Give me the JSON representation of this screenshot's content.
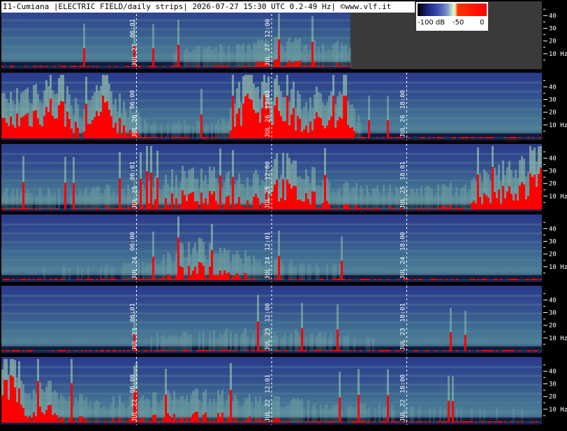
{
  "header": {
    "title": "I1-Cumiana |ELECTRIC FIELD/daily strips| 2026-07-27 15:30 UTC 0.2-49 Hz| ©www.vlf.it"
  },
  "colorbar": {
    "labels": [
      "-100 dB",
      "-50",
      "0"
    ],
    "colors": [
      "#000000",
      "#1a237e",
      "#5c6bc0",
      "#c8e6c9",
      "#ff0000"
    ]
  },
  "colors": {
    "background": "#000000",
    "no_data": "#3a3a3a",
    "spectrogram_low": "#283593",
    "spectrogram_mid": "#6a9a8a",
    "spectrogram_high": "#c8e6c9",
    "saturation": "#ff0000"
  },
  "chart_data": {
    "type": "heatmap",
    "ylabel": "Hz",
    "y_ticks": [
      {
        "value": 10,
        "label": "10 Hz"
      },
      {
        "value": 20,
        "label": "20"
      },
      {
        "value": 30,
        "label": "30"
      },
      {
        "value": 40,
        "label": "40"
      }
    ],
    "ylim": [
      0,
      49
    ],
    "xlim_hours": [
      0,
      24
    ],
    "strips": [
      {
        "date_label": "JUL 27",
        "data_until_hour": 15.5,
        "markers": [
          {
            "hour": 6,
            "label": "06:01"
          },
          {
            "hour": 12,
            "label": "12:00"
          }
        ],
        "activity": [
          {
            "h": 0,
            "v": 0.1
          },
          {
            "h": 6,
            "v": 0.15
          },
          {
            "h": 11,
            "v": 0.35
          },
          {
            "h": 13,
            "v": 0.4
          },
          {
            "h": 15.5,
            "v": 0.3
          }
        ]
      },
      {
        "date_label": "JUL 26",
        "data_until_hour": 24,
        "markers": [
          {
            "hour": 6,
            "label": "06:00"
          },
          {
            "hour": 12,
            "label": "12:01"
          },
          {
            "hour": 18,
            "label": "18:00"
          }
        ],
        "activity": [
          {
            "h": 0,
            "v": 0.6
          },
          {
            "h": 1,
            "v": 0.75
          },
          {
            "h": 2.5,
            "v": 0.95
          },
          {
            "h": 3.5,
            "v": 0.4
          },
          {
            "h": 4.5,
            "v": 0.85
          },
          {
            "h": 6.5,
            "v": 0.2
          },
          {
            "h": 10,
            "v": 0.25
          },
          {
            "h": 10.5,
            "v": 0.9
          },
          {
            "h": 11.5,
            "v": 1.0
          },
          {
            "h": 13,
            "v": 0.7
          },
          {
            "h": 15.5,
            "v": 0.6
          },
          {
            "h": 16,
            "v": 0.15
          },
          {
            "h": 24,
            "v": 0.1
          }
        ]
      },
      {
        "date_label": "JUL 25",
        "data_until_hour": 24,
        "markers": [
          {
            "hour": 6,
            "label": "06:01"
          },
          {
            "hour": 12,
            "label": "12:00"
          },
          {
            "hour": 18,
            "label": "18:01"
          }
        ],
        "activity": [
          {
            "h": 0,
            "v": 0.3
          },
          {
            "h": 3,
            "v": 0.25
          },
          {
            "h": 6.5,
            "v": 0.4
          },
          {
            "h": 8,
            "v": 0.55
          },
          {
            "h": 11.5,
            "v": 0.5
          },
          {
            "h": 12,
            "v": 0.8
          },
          {
            "h": 15,
            "v": 0.35
          },
          {
            "h": 18,
            "v": 0.3
          },
          {
            "h": 20.5,
            "v": 0.35
          },
          {
            "h": 22,
            "v": 0.6
          },
          {
            "h": 24,
            "v": 0.9
          }
        ]
      },
      {
        "date_label": "JUL 24",
        "data_until_hour": 24,
        "markers": [
          {
            "hour": 6,
            "label": "06:00"
          },
          {
            "hour": 12,
            "label": "12:01"
          },
          {
            "hour": 18,
            "label": "18:00"
          }
        ],
        "activity": [
          {
            "h": 0,
            "v": 0.15
          },
          {
            "h": 5,
            "v": 0.2
          },
          {
            "h": 7,
            "v": 0.3
          },
          {
            "h": 8.5,
            "v": 0.6
          },
          {
            "h": 9.5,
            "v": 0.45
          },
          {
            "h": 12,
            "v": 0.3
          },
          {
            "h": 15,
            "v": 0.2
          },
          {
            "h": 18,
            "v": 0.1
          },
          {
            "h": 24,
            "v": 0.05
          }
        ]
      },
      {
        "date_label": "JUL 23",
        "data_until_hour": 24,
        "markers": [
          {
            "hour": 6,
            "label": "06:01"
          },
          {
            "hour": 12,
            "label": "12:00"
          },
          {
            "hour": 18,
            "label": "18:01"
          }
        ],
        "activity": [
          {
            "h": 0,
            "v": 0.05
          },
          {
            "h": 6,
            "v": 0.1
          },
          {
            "h": 7,
            "v": 0.25
          },
          {
            "h": 12,
            "v": 0.3
          },
          {
            "h": 16,
            "v": 0.2
          },
          {
            "h": 20,
            "v": 0.1
          },
          {
            "h": 24,
            "v": 0.05
          }
        ]
      },
      {
        "date_label": "JUL 22",
        "data_until_hour": 24,
        "markers": [
          {
            "hour": 6,
            "label": "06:00"
          },
          {
            "hour": 12,
            "label": "12:01"
          },
          {
            "hour": 18,
            "label": "18:00"
          }
        ],
        "activity": [
          {
            "h": 0,
            "v": 1.0
          },
          {
            "h": 0.6,
            "v": 0.9
          },
          {
            "h": 1,
            "v": 0.5
          },
          {
            "h": 2,
            "v": 0.55
          },
          {
            "h": 4,
            "v": 0.3
          },
          {
            "h": 7,
            "v": 0.4
          },
          {
            "h": 9,
            "v": 0.45
          },
          {
            "h": 12,
            "v": 0.35
          },
          {
            "h": 15,
            "v": 0.25
          },
          {
            "h": 20,
            "v": 0.2
          },
          {
            "h": 24,
            "v": 0.15
          }
        ]
      }
    ]
  }
}
